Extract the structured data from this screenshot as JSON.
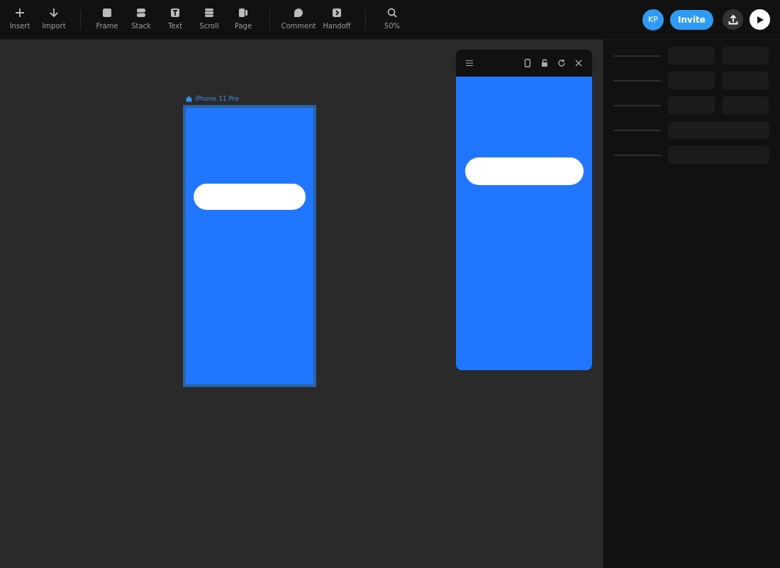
{
  "toolbar": {
    "groups": [
      {
        "tools": [
          {
            "label": "Insert",
            "kind": "plus"
          },
          {
            "label": "Import",
            "kind": "import"
          }
        ]
      },
      {
        "tools": [
          {
            "label": "Frame",
            "kind": "frame"
          },
          {
            "label": "Stack",
            "kind": "stack"
          },
          {
            "label": "Text",
            "kind": "text"
          },
          {
            "label": "Scroll",
            "kind": "scroll"
          },
          {
            "label": "Page",
            "kind": "page"
          }
        ]
      },
      {
        "tools": [
          {
            "label": "Comment",
            "kind": "comment"
          },
          {
            "label": "Handoff",
            "kind": "handoff"
          }
        ]
      },
      {
        "tools": [
          {
            "label": "50%",
            "kind": "zoom"
          }
        ]
      }
    ]
  },
  "user": {
    "initials": "KP"
  },
  "invite_button": "Invite",
  "frame": {
    "label": "iPhone 11 Pro",
    "selected": true
  },
  "inspector": {
    "rows": [
      {
        "kind": "pair"
      },
      {
        "kind": "pair"
      },
      {
        "kind": "pair"
      },
      {
        "kind": "wide"
      },
      {
        "kind": "wide"
      }
    ]
  }
}
